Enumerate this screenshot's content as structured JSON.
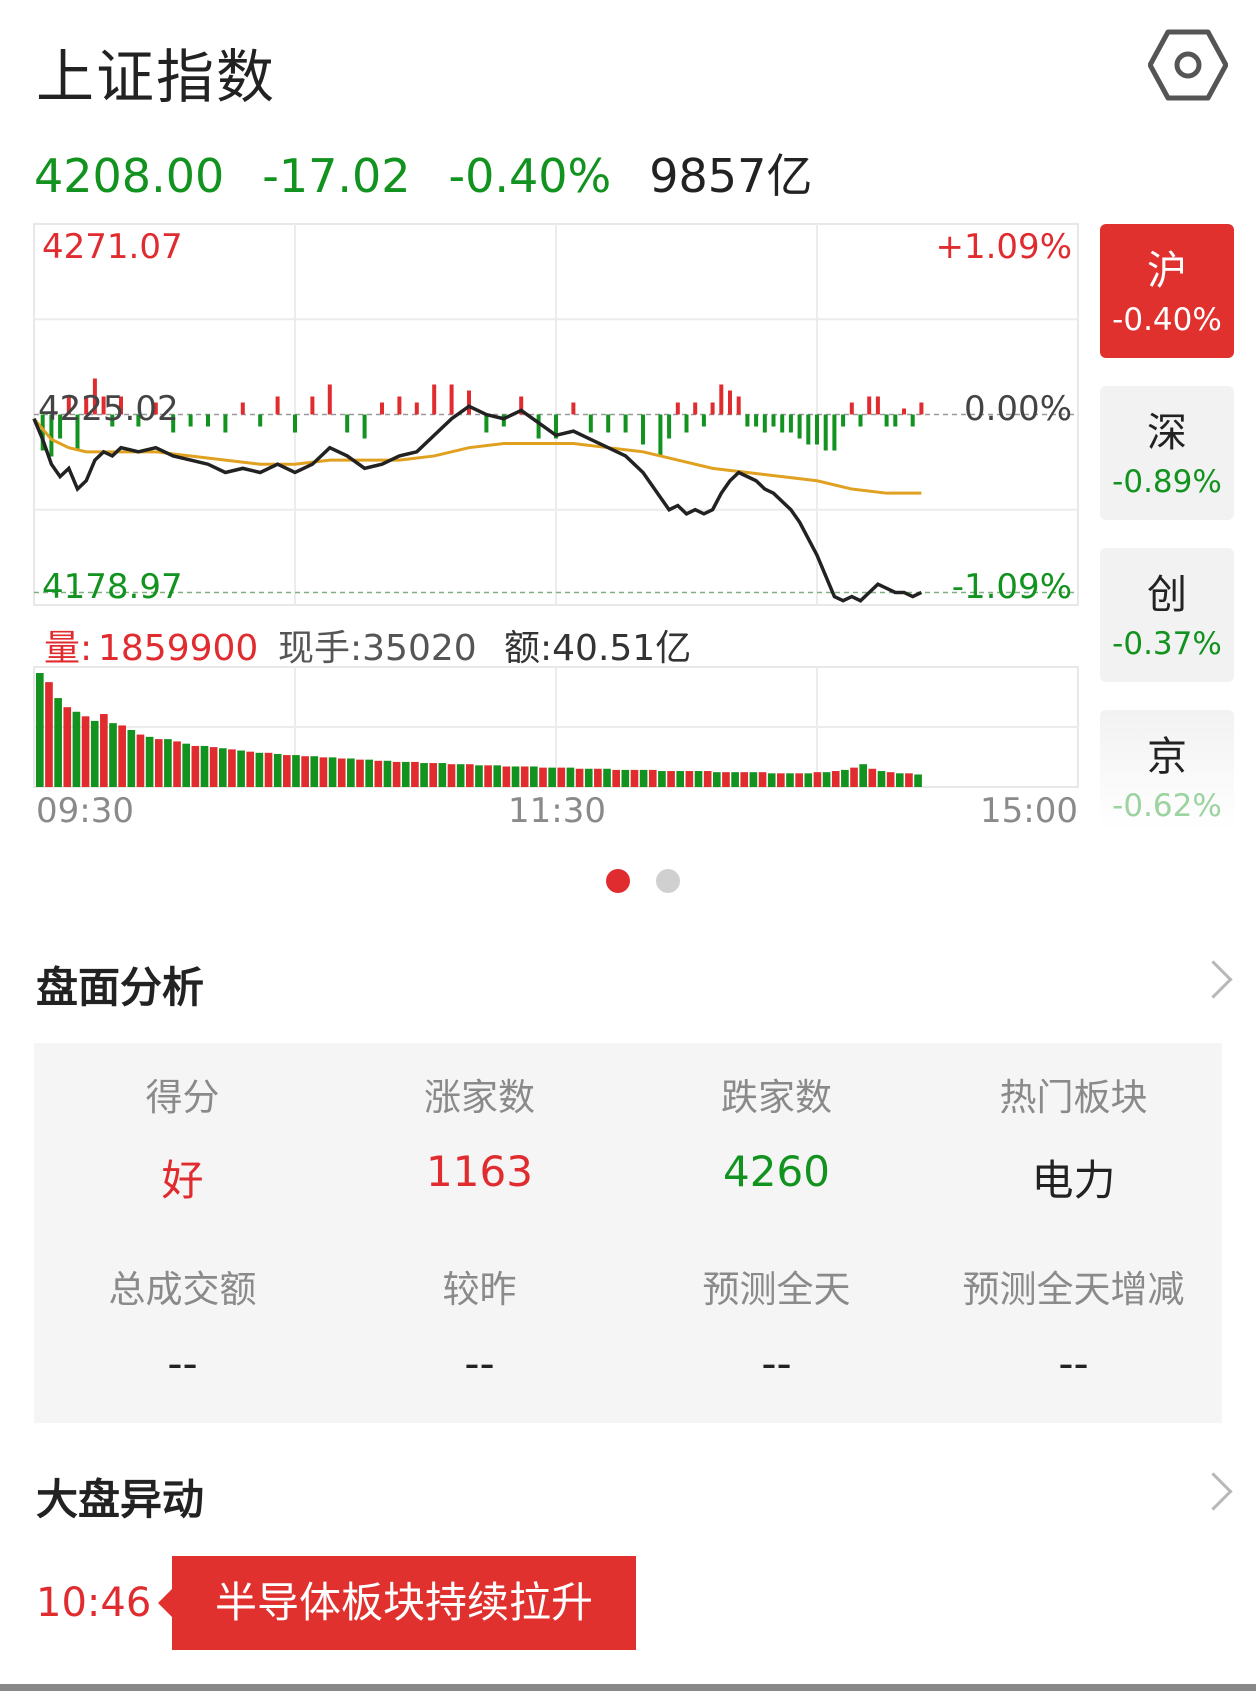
{
  "header": {
    "title": "上证指数",
    "settings_icon": "hexagon-settings-icon"
  },
  "quote": {
    "price": "4208.00",
    "change": "-17.02",
    "change_pct": "-0.40%",
    "turnover": "9857亿"
  },
  "colors": {
    "up": "#e02b2f",
    "down": "#12921e",
    "price_line": "#222222",
    "avg_line": "#e0a020"
  },
  "chart_data": {
    "type": "line",
    "title": "",
    "y_high_label": "4271.07",
    "y_low_label": "4178.97",
    "y_prev_label": "4225.02",
    "pct_high_label": "+1.09%",
    "pct_zero_label": "0.00%",
    "pct_low_label": "-1.09%",
    "ylim": [
      4178.97,
      4271.07
    ],
    "prev_close": 4225.02,
    "x_labels": [
      "09:30",
      "11:30",
      "15:00"
    ],
    "x_minutes_total": 240,
    "price_series_name": "",
    "price": [
      [
        0,
        4224
      ],
      [
        2,
        4219
      ],
      [
        4,
        4213
      ],
      [
        6,
        4210
      ],
      [
        8,
        4212
      ],
      [
        10,
        4207
      ],
      [
        12,
        4209
      ],
      [
        14,
        4214
      ],
      [
        16,
        4216
      ],
      [
        18,
        4215
      ],
      [
        20,
        4217
      ],
      [
        24,
        4216
      ],
      [
        28,
        4217
      ],
      [
        32,
        4215
      ],
      [
        36,
        4214
      ],
      [
        40,
        4213
      ],
      [
        44,
        4211
      ],
      [
        48,
        4212
      ],
      [
        52,
        4211
      ],
      [
        56,
        4213
      ],
      [
        60,
        4211
      ],
      [
        64,
        4213
      ],
      [
        68,
        4217
      ],
      [
        72,
        4215
      ],
      [
        76,
        4212
      ],
      [
        80,
        4213
      ],
      [
        84,
        4215
      ],
      [
        88,
        4216
      ],
      [
        92,
        4220
      ],
      [
        96,
        4224
      ],
      [
        100,
        4227
      ],
      [
        104,
        4225
      ],
      [
        108,
        4224
      ],
      [
        112,
        4226
      ],
      [
        116,
        4223
      ],
      [
        120,
        4220
      ],
      [
        124,
        4221
      ],
      [
        128,
        4219
      ],
      [
        132,
        4217
      ],
      [
        136,
        4215
      ],
      [
        140,
        4211
      ],
      [
        144,
        4205
      ],
      [
        146,
        4202
      ],
      [
        148,
        4203
      ],
      [
        150,
        4201
      ],
      [
        152,
        4202
      ],
      [
        154,
        4201
      ],
      [
        156,
        4202
      ],
      [
        158,
        4206
      ],
      [
        160,
        4209
      ],
      [
        162,
        4211
      ],
      [
        164,
        4210
      ],
      [
        166,
        4209
      ],
      [
        168,
        4207
      ],
      [
        170,
        4206
      ],
      [
        172,
        4204
      ],
      [
        174,
        4202
      ],
      [
        176,
        4199
      ],
      [
        178,
        4195
      ],
      [
        180,
        4191
      ],
      [
        182,
        4186
      ],
      [
        184,
        4181
      ],
      [
        186,
        4180
      ],
      [
        188,
        4181
      ],
      [
        190,
        4180
      ],
      [
        192,
        4182
      ],
      [
        194,
        4184
      ],
      [
        196,
        4183
      ],
      [
        198,
        4182
      ],
      [
        200,
        4182
      ],
      [
        202,
        4181
      ],
      [
        204,
        4182
      ]
    ],
    "avg": [
      [
        0,
        4224
      ],
      [
        4,
        4219
      ],
      [
        8,
        4217
      ],
      [
        12,
        4216
      ],
      [
        16,
        4216
      ],
      [
        20,
        4216
      ],
      [
        28,
        4216
      ],
      [
        36,
        4215
      ],
      [
        44,
        4214
      ],
      [
        52,
        4213
      ],
      [
        60,
        4213
      ],
      [
        68,
        4214
      ],
      [
        76,
        4214
      ],
      [
        84,
        4214
      ],
      [
        92,
        4215
      ],
      [
        100,
        4217
      ],
      [
        108,
        4218
      ],
      [
        116,
        4218
      ],
      [
        124,
        4218
      ],
      [
        132,
        4217
      ],
      [
        140,
        4216
      ],
      [
        148,
        4214
      ],
      [
        156,
        4212
      ],
      [
        164,
        4211
      ],
      [
        172,
        4210
      ],
      [
        180,
        4209
      ],
      [
        188,
        4207
      ],
      [
        196,
        4206
      ],
      [
        204,
        4206
      ]
    ],
    "volume_label": "量:",
    "volume_value": "1859900",
    "hand_label": "现手:35020",
    "amount_label": "额:40.51亿",
    "volume": [
      100,
      92,
      78,
      70,
      66,
      62,
      58,
      64,
      56,
      54,
      50,
      46,
      44,
      42,
      42,
      40,
      38,
      36,
      36,
      35,
      34,
      33,
      32,
      31,
      30,
      30,
      29,
      28,
      28,
      27,
      27,
      26,
      26,
      25,
      25,
      24,
      24,
      23,
      23,
      22,
      22,
      22,
      21,
      21,
      21,
      20,
      20,
      20,
      19,
      19,
      19,
      18,
      18,
      18,
      18,
      17,
      17,
      17,
      17,
      16,
      16,
      16,
      16,
      15,
      15,
      15,
      15,
      15,
      14,
      14,
      14,
      14,
      14,
      14,
      13,
      13,
      13,
      13,
      13,
      13,
      12,
      12,
      12,
      12,
      12,
      13,
      13,
      14,
      15,
      17,
      20,
      16,
      14,
      13,
      12,
      12,
      11
    ]
  },
  "exchange_tabs": [
    {
      "name": "沪",
      "pct": "-0.40%"
    },
    {
      "name": "深",
      "pct": "-0.89%"
    },
    {
      "name": "创",
      "pct": "-0.37%"
    },
    {
      "name": "京",
      "pct": "-0.62%"
    }
  ],
  "analysis": {
    "title": "盘面分析",
    "cells": [
      {
        "label": "得分",
        "value": "好"
      },
      {
        "label": "涨家数",
        "value": "1163"
      },
      {
        "label": "跌家数",
        "value": "4260"
      },
      {
        "label": "热门板块",
        "value": "电力"
      },
      {
        "label": "总成交额",
        "value": "--"
      },
      {
        "label": "较昨",
        "value": "--"
      },
      {
        "label": "预测全天",
        "value": "--"
      },
      {
        "label": "预测全天增减",
        "value": "--"
      }
    ]
  },
  "movement": {
    "title": "大盘异动",
    "time": "10:46",
    "text": "半导体板块持续拉升"
  }
}
